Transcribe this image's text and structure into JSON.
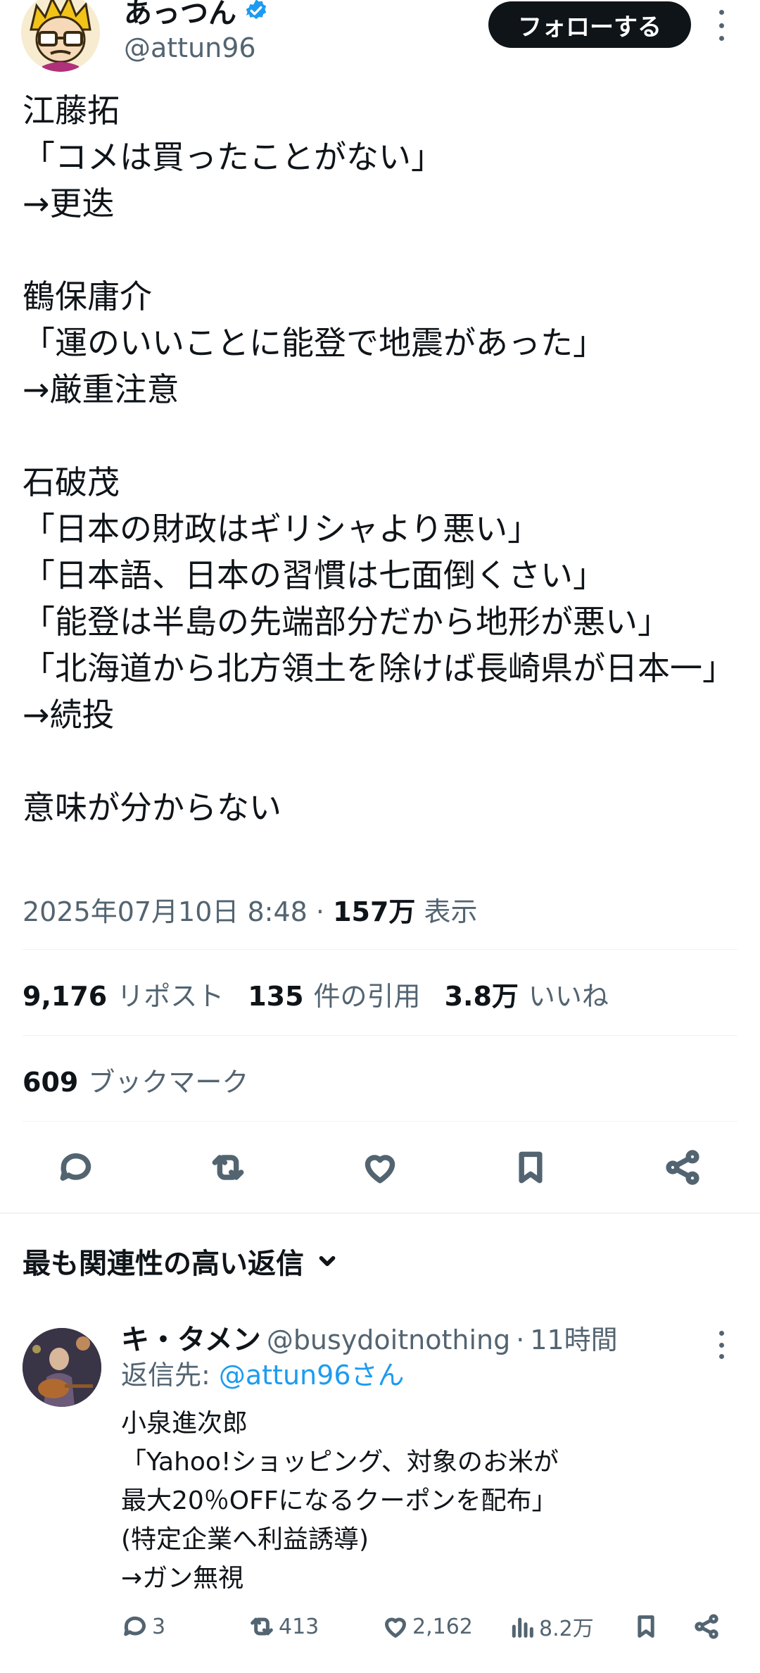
{
  "author": {
    "display_name": "あっつん",
    "handle": "@attun96",
    "follow_label": "フォローする"
  },
  "tweet": {
    "lines": [
      "江藤拓",
      "「コメは買ったことがない」",
      "→更迭",
      "",
      "鶴保庸介",
      "「運のいいことに能登で地震があった」",
      "→厳重注意",
      "",
      "石破茂",
      "「日本の財政はギリシャより悪い」",
      "「日本語、日本の習慣は七面倒くさい」",
      "「能登は半島の先端部分だから地形が悪い」",
      "「北海道から北方領土を除けば長崎県が日本一」",
      "→続投",
      "",
      "意味が分からない"
    ],
    "timestamp": "2025年07月10日 8:48",
    "separator": "·",
    "views_count": "157万",
    "views_label": "表示"
  },
  "stats": {
    "reposts_count": "9,176",
    "reposts_label": "リポスト",
    "quotes_count": "135",
    "quotes_label": "件の引用",
    "likes_count": "3.8万",
    "likes_label": "いいね",
    "bookmarks_count": "609",
    "bookmarks_label": "ブックマーク"
  },
  "replies_sort": {
    "label": "最も関連性の高い返信"
  },
  "reply": {
    "display_name": "キ・タメン",
    "handle": "@busydoitnothing",
    "separator": "·",
    "time": "11時間",
    "reply_to_prefix": "返信先: ",
    "reply_to_mention": "@attun96さん",
    "lines": [
      "小泉進次郎",
      "「Yahoo!ショッピング、対象のお米が",
      "最大20％OFFになるクーポンを配布」",
      "(特定企業へ利益誘導)",
      "→ガン無視"
    ],
    "replies_count": "3",
    "reposts_count": "413",
    "likes_count": "2,162",
    "views_count": "8.2万"
  },
  "colors": {
    "text_primary": "#0f1419",
    "text_secondary": "#536471",
    "accent_blue": "#1d9bf0",
    "divider": "#eff3f4"
  }
}
